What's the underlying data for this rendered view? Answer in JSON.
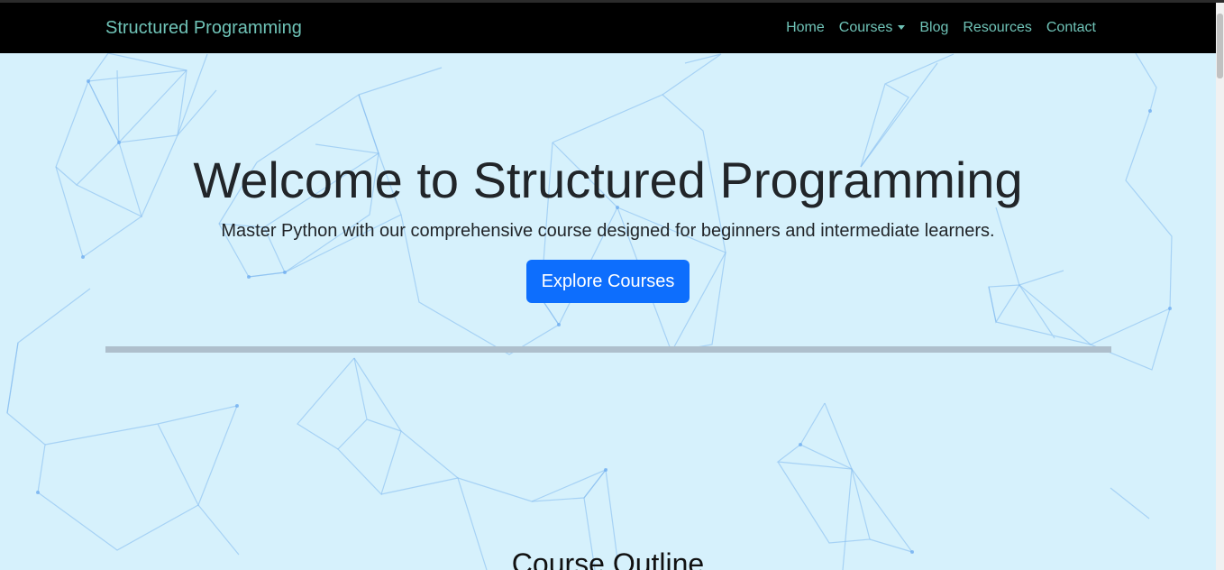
{
  "navbar": {
    "brand": "Structured Programming",
    "items": [
      {
        "label": "Home"
      },
      {
        "label": "Courses",
        "dropdown": true
      },
      {
        "label": "Blog"
      },
      {
        "label": "Resources"
      },
      {
        "label": "Contact"
      }
    ]
  },
  "hero": {
    "title": "Welcome to Structured Programming",
    "subtitle": "Master Python with our comprehensive course designed for beginners and intermediate learners.",
    "cta_label": "Explore Courses"
  },
  "section": {
    "title": "Course Outline"
  },
  "colors": {
    "navbar_bg": "#000000",
    "nav_text": "#6fc3b7",
    "page_bg": "#d6f1fc",
    "accent": "#0d6efd",
    "network_lines": "#8fc2f0"
  },
  "icons": {
    "dropdown": "caret-down-icon",
    "background": "network-lines-decoration"
  }
}
